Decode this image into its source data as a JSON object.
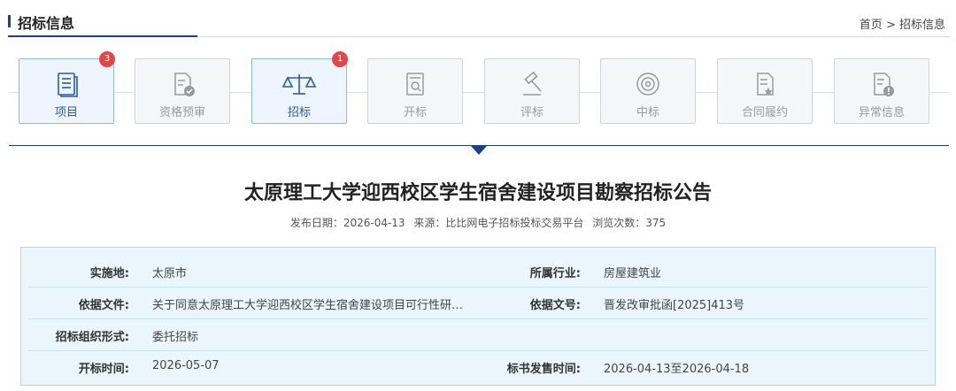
{
  "header": {
    "title": "招标信息"
  },
  "breadcrumb": {
    "home": "首页",
    "separator": ">",
    "current": "招标信息"
  },
  "steps": [
    {
      "label": "项目",
      "icon": "document-list-icon",
      "active": true,
      "badge": "3"
    },
    {
      "label": "资格预审",
      "icon": "document-check-icon",
      "active": false
    },
    {
      "label": "招标",
      "icon": "scale-icon",
      "active": true,
      "badge": "1"
    },
    {
      "label": "开标",
      "icon": "document-search-icon",
      "active": false
    },
    {
      "label": "评标",
      "icon": "gavel-icon",
      "active": false
    },
    {
      "label": "中标",
      "icon": "target-icon",
      "active": false
    },
    {
      "label": "合同履约",
      "icon": "contract-icon",
      "active": false
    },
    {
      "label": "异常信息",
      "icon": "document-alert-icon",
      "active": false
    }
  ],
  "article": {
    "title": "太原理工大学迎西校区学生宿舍建设项目勘察招标公告",
    "publish_date": "发布日期：2026-04-13",
    "source": "来源：比比网电子招标投标交易平台",
    "views": "浏览次数：375"
  },
  "info": {
    "location_label": "实施地:",
    "location": "太原市",
    "industry_label": "所属行业:",
    "industry": "房屋建筑业",
    "basis_file_label": "依据文件:",
    "basis_file": "关于同意太原理工大学迎西校区学生宿舍建设项目可行性研…",
    "basis_no_label": "依据文号:",
    "basis_no": "晋发改审批函[2025]413号",
    "org_form_label": "招标组织形式:",
    "org_form": "委托招标",
    "open_time_label": "开标时间:",
    "open_time": "2026-05-07",
    "sale_time_label": "标书发售时间:",
    "sale_time": "2026-04-13至2026-04-18"
  },
  "colors": {
    "primary": "#1f3f8a",
    "badge": "#e64545",
    "info_bg": "#eaf5fc",
    "active_step": "#2b5aa3"
  }
}
